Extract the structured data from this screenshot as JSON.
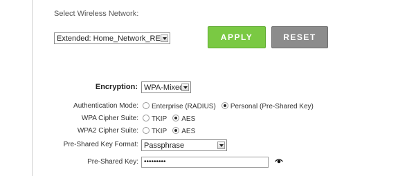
{
  "network": {
    "label": "Select Wireless Network:",
    "selected": "Extended: Home_Network_RE"
  },
  "buttons": {
    "apply": "APPLY",
    "reset": "RESET",
    "apply_color": "#7ac943",
    "reset_color": "#8c8c8c"
  },
  "encryption": {
    "label": "Encryption:",
    "selected": "WPA-Mixed"
  },
  "auth_mode": {
    "label": "Authentication Mode:",
    "options": [
      "Enterprise (RADIUS)",
      "Personal (Pre-Shared Key)"
    ],
    "selected": "Personal (Pre-Shared Key)"
  },
  "wpa_cipher": {
    "label": "WPA Cipher Suite:",
    "options": [
      "TKIP",
      "AES"
    ],
    "selected": "AES"
  },
  "wpa2_cipher": {
    "label": "WPA2 Cipher Suite:",
    "options": [
      "TKIP",
      "AES"
    ],
    "selected": "AES"
  },
  "psk_format": {
    "label": "Pre-Shared Key Format:",
    "selected": "Passphrase"
  },
  "psk": {
    "label": "Pre-Shared Key:",
    "value": "•••••••••",
    "toggle_icon": "eye-icon"
  }
}
